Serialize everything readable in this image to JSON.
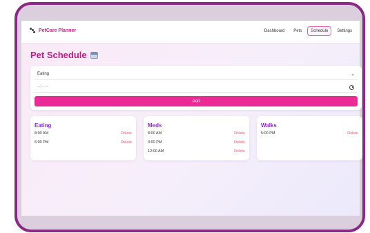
{
  "nav": {
    "brand": "PetCare Planner",
    "links": [
      "Dashboard",
      "Pets",
      "Schedule",
      "Settings"
    ],
    "active": "Schedule"
  },
  "page": {
    "title": "Pet Schedule"
  },
  "form": {
    "activity_value": "Eating",
    "time_placeholder": "--:-- --",
    "add_label": "Add"
  },
  "cards": [
    {
      "title": "Eating",
      "entries": [
        {
          "time": "8:00 AM",
          "action": "Delete"
        },
        {
          "time": "6:00 PM",
          "action": "Delete"
        }
      ]
    },
    {
      "title": "Meds",
      "entries": [
        {
          "time": "8:00 AM",
          "action": "Delete"
        },
        {
          "time": "4:00 PM",
          "action": "Delete"
        },
        {
          "time": "12:00 AM",
          "action": "Delete"
        }
      ]
    },
    {
      "title": "Walks",
      "entries": [
        {
          "time": "5:00 PM",
          "action": "Delete"
        }
      ]
    }
  ],
  "colors": {
    "frame": "#8b2a86",
    "accent": "#ec2a95",
    "title": "#c21a8a",
    "card_title": "#8a2cc4",
    "delete": "#e8566e"
  }
}
